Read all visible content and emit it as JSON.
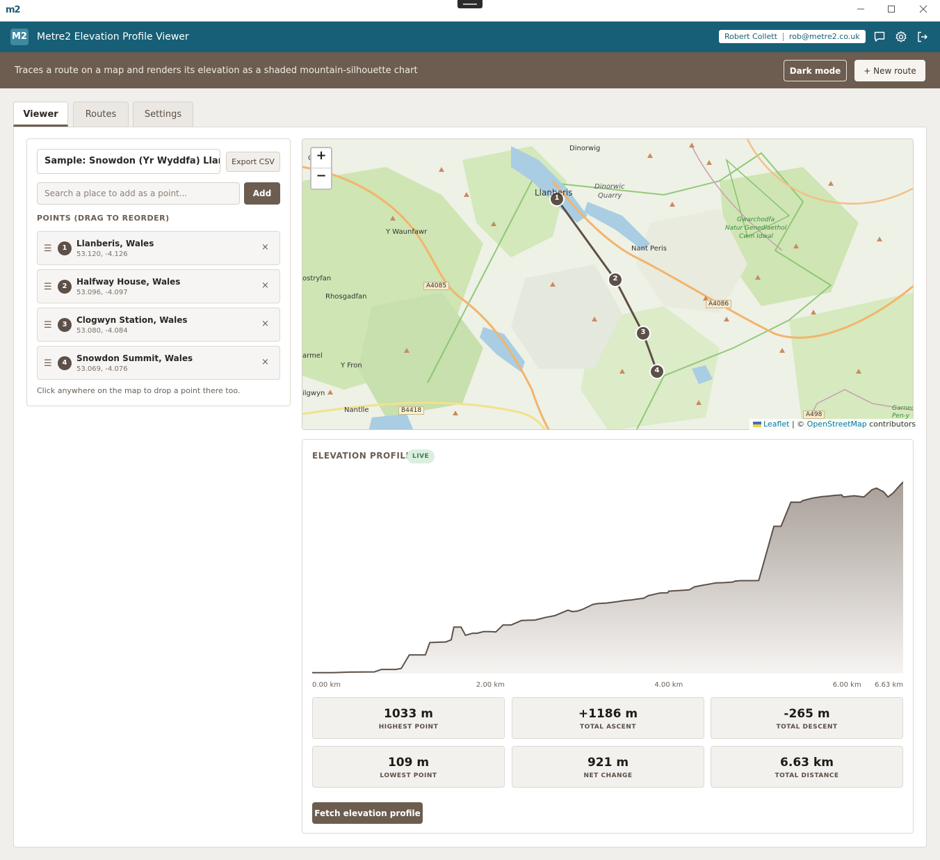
{
  "window": {
    "logo": "m2"
  },
  "app": {
    "badge": "M2",
    "title": "Metre2 Elevation Profile Viewer",
    "user_name": "Robert Collett",
    "user_email": "rob@metre2.co.uk",
    "description": "Traces a route on a map and renders its elevation as a shaded mountain-silhouette chart",
    "dark_mode_label": "Dark mode",
    "new_route_label": "+ New route"
  },
  "tabs": [
    {
      "label": "Viewer"
    },
    {
      "label": "Routes"
    },
    {
      "label": "Settings"
    }
  ],
  "editor": {
    "route_name": "Sample: Snowdon (Yr Wyddfa) Llanberis Path",
    "export_label": "Export CSV",
    "search_placeholder": "Search a place to add as a point...",
    "add_label": "Add",
    "points_title": "POINTS (DRAG TO REORDER)",
    "points": [
      {
        "num": "1",
        "name": "Llanberis, Wales",
        "coords": "53.120, -4.126"
      },
      {
        "num": "2",
        "name": "Halfway House, Wales",
        "coords": "53.096, -4.097"
      },
      {
        "num": "3",
        "name": "Clogwyn Station, Wales",
        "coords": "53.080, -4.084"
      },
      {
        "num": "4",
        "name": "Snowdon Summit, Wales",
        "coords": "53.069, -4.076"
      }
    ],
    "hint": "Click anywhere on the map to drop a point there too."
  },
  "map": {
    "zoom_in": "+",
    "zoom_out": "−",
    "labels": {
      "dinorwig": "Dinorwig",
      "llanberis": "Llanberis",
      "dinorwic": "Dinorwic",
      "quarry": "Quarry",
      "waunfawr": "Y Waunfawr",
      "nant_peris": "Nant Peris",
      "gwarchodfa": "Gwarchodfa",
      "natur": "Natur Genedlaethol",
      "cwm": "Cwm Idwal",
      "bostryfan": "ostryfan",
      "rhosgadfan": "Rhosgadfan",
      "a4085": "A4085",
      "a4086": "A4086",
      "carmel": "armel",
      "y_fron": "Y Fron",
      "ilgwyn": "ilgwyn",
      "nantlle": "Nantlle",
      "b4418": "B4418",
      "a498": "A498",
      "garnedd": "Garnec",
      "pen_y": "Pen-y",
      "caeathro": "C o"
    },
    "attribution": {
      "leaflet": "Leaflet",
      "sep": " | © ",
      "osm": "OpenStreetMap",
      "contrib": " contributors"
    },
    "markers": [
      "1",
      "2",
      "3",
      "4"
    ]
  },
  "elevation": {
    "title": "ELEVATION PROFILE",
    "status": "LIVE",
    "fetch_label": "Fetch elevation profile",
    "stats": [
      {
        "value": "1033 m",
        "label": "HIGHEST POINT"
      },
      {
        "value": "+1186 m",
        "label": "TOTAL ASCENT"
      },
      {
        "value": "-265 m",
        "label": "TOTAL DESCENT"
      },
      {
        "value": "109 m",
        "label": "LOWEST POINT"
      },
      {
        "value": "921 m",
        "label": "NET CHANGE"
      },
      {
        "value": "6.63 km",
        "label": "TOTAL DISTANCE"
      }
    ]
  },
  "chart_data": {
    "type": "area",
    "xlabel": "",
    "ylabel": "",
    "xlim": [
      0,
      6.63
    ],
    "ylim": [
      105,
      1035
    ],
    "x_ticks": [
      "0.00 km",
      "2.00 km",
      "4.00 km",
      "6.00 km",
      "6.63 km"
    ],
    "x_tick_values": [
      0,
      2.0,
      4.0,
      6.0,
      6.63
    ],
    "grid": false,
    "series": [
      {
        "x": [
          0,
          0.23,
          0.43,
          0.7,
          0.78,
          0.94,
          1.0,
          1.09,
          1.27,
          1.32,
          1.5,
          1.56,
          1.59,
          1.67,
          1.72,
          1.8,
          1.85,
          1.92,
          2.0,
          2.06,
          2.14,
          2.23,
          2.35,
          2.5,
          2.62,
          2.72,
          2.87,
          2.92,
          2.98,
          3.04,
          3.15,
          3.21,
          3.3,
          3.47,
          3.52,
          3.59,
          3.63,
          3.72,
          3.77,
          3.9,
          3.99,
          4.0,
          4.23,
          4.29,
          4.35,
          4.53,
          4.62,
          4.72,
          4.74,
          4.81,
          4.97,
          5.01,
          5.18,
          5.26,
          5.37,
          5.48,
          5.5,
          5.62,
          5.72,
          5.76,
          5.87,
          5.94,
          5.96,
          6.08,
          6.19,
          6.28,
          6.33,
          6.41,
          6.46,
          6.52,
          6.57,
          6.63
        ],
        "y": [
          109,
          109,
          112,
          113,
          125,
          125,
          130,
          195,
          195,
          255,
          258,
          268,
          330,
          330,
          290,
          300,
          300,
          308,
          308,
          306,
          340,
          340,
          362,
          364,
          377,
          385,
          412,
          405,
          408,
          417,
          440,
          444,
          446,
          456,
          459,
          462,
          465,
          470,
          482,
          495,
          496,
          504,
          510,
          525,
          530,
          544,
          545,
          548,
          552,
          555,
          555,
          556,
          818,
          818,
          935,
          935,
          942,
          955,
          962,
          963,
          968,
          970,
          960,
          966,
          960,
          995,
          1003,
          985,
          960,
          980,
          1005,
          1033
        ]
      }
    ]
  }
}
